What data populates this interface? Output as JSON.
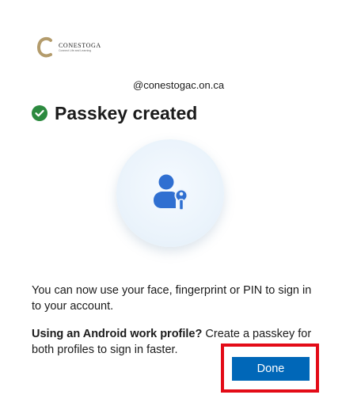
{
  "brand": {
    "name": "CONESTOGA",
    "tagline": "Connect Life and Learning"
  },
  "account": {
    "email": "@conestogac.on.ca"
  },
  "header": {
    "title": "Passkey created"
  },
  "message": {
    "main": "You can now use your face, fingerprint or PIN to sign in to your account.",
    "android_bold": "Using an Android work profile?",
    "android_rest": " Create a passkey for both profiles to sign in faster."
  },
  "actions": {
    "done_label": "Done"
  },
  "colors": {
    "accent": "#0067b8",
    "success": "#2c8a3f",
    "highlight": "#e30b17",
    "icon_blue": "#2f6fd1"
  },
  "icons": {
    "success": "check-circle-icon",
    "illustration": "person-key-icon",
    "brand": "conestoga-logo"
  }
}
